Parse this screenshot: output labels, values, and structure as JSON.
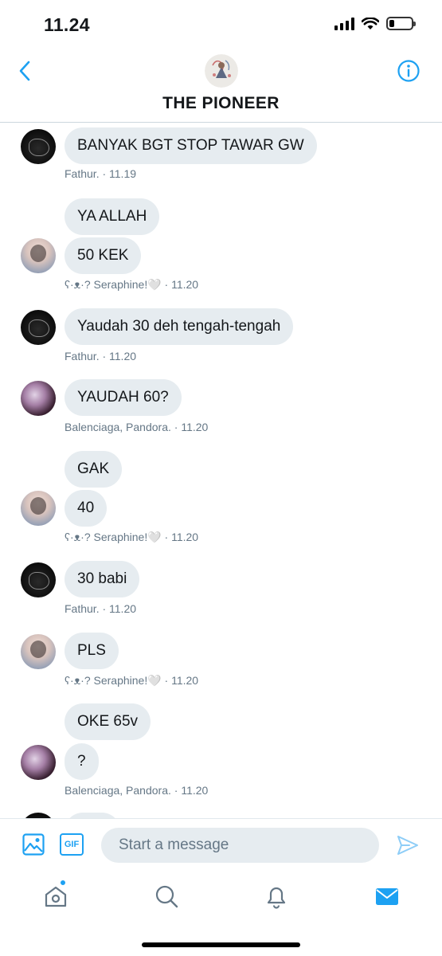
{
  "status_bar": {
    "time": "11.24"
  },
  "header": {
    "title": "THE PIONEER",
    "back_icon": "chevron-left-icon",
    "info_icon": "info-icon",
    "accent_color": "#1da1f2"
  },
  "messages": [
    {
      "sender": "fathur",
      "bubbles": [
        "BANYAK BGT STOP TAWAR GW"
      ],
      "meta": "Fathur. · 11.19"
    },
    {
      "sender": "seraphine",
      "bubbles": [
        "YA ALLAH",
        "50 KEK"
      ],
      "meta": "ʕ·ᴥ·? Seraphine!🤍 · 11.20"
    },
    {
      "sender": "fathur",
      "bubbles": [
        "Yaudah 30 deh tengah-tengah"
      ],
      "meta": "Fathur. · 11.20"
    },
    {
      "sender": "balenciaga",
      "bubbles": [
        "YAUDAH 60?"
      ],
      "meta": "Balenciaga, Pandora. · 11.20"
    },
    {
      "sender": "seraphine",
      "bubbles": [
        "GAK",
        "40"
      ],
      "meta": "ʕ·ᴥ·? Seraphine!🤍 · 11.20"
    },
    {
      "sender": "fathur",
      "bubbles": [
        "30 babi"
      ],
      "meta": "Fathur. · 11.20"
    },
    {
      "sender": "seraphine",
      "bubbles": [
        "PLS"
      ],
      "meta": "ʕ·ᴥ·? Seraphine!🤍 · 11.20"
    },
    {
      "sender": "balenciaga",
      "bubbles": [
        "OKE 65v",
        "?"
      ],
      "meta": "Balenciaga, Pandora. · 11.20"
    }
  ],
  "composer": {
    "placeholder": "Start a message",
    "gif_label": "GIF",
    "image_icon": "image-icon",
    "send_icon": "send-icon"
  },
  "tab_bar": {
    "items": [
      {
        "name": "home",
        "icon": "home-icon",
        "has_badge": true
      },
      {
        "name": "search",
        "icon": "search-icon"
      },
      {
        "name": "notifications",
        "icon": "bell-icon"
      },
      {
        "name": "messages",
        "icon": "mail-icon",
        "active": true
      }
    ]
  }
}
